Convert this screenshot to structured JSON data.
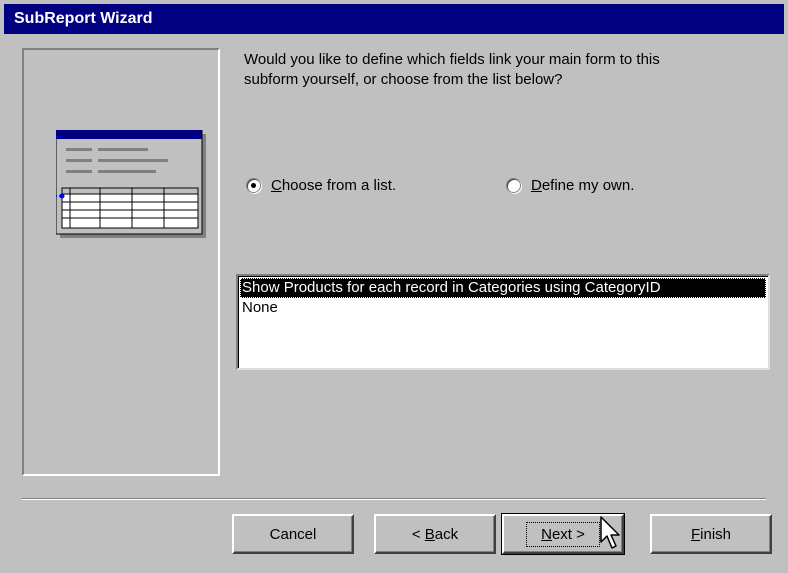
{
  "window": {
    "title": "SubReport Wizard"
  },
  "prompt": {
    "line1": "Would you like to define which fields link your main form to this",
    "line2": "subform yourself, or choose from the list below?"
  },
  "options": {
    "choose_from_list": {
      "prefix": "",
      "mnemonic": "C",
      "rest": "hoose from a list.",
      "checked": true
    },
    "define_my_own": {
      "prefix": "",
      "mnemonic": "D",
      "rest": "efine my own.",
      "checked": false
    }
  },
  "link_list": {
    "items": [
      {
        "label": "Show Products for each record in Categories using CategoryID",
        "selected": true
      },
      {
        "label": "None",
        "selected": false
      }
    ]
  },
  "buttons": {
    "cancel": {
      "label": "Cancel"
    },
    "back": {
      "prefix": "< ",
      "mnemonic": "B",
      "rest": "ack"
    },
    "next": {
      "mnemonic": "N",
      "rest": "ext >"
    },
    "finish": {
      "mnemonic": "F",
      "rest": "inish"
    }
  },
  "colors": {
    "titlebar": "#000080",
    "face": "#c0c0c0",
    "selection": "#000000"
  }
}
